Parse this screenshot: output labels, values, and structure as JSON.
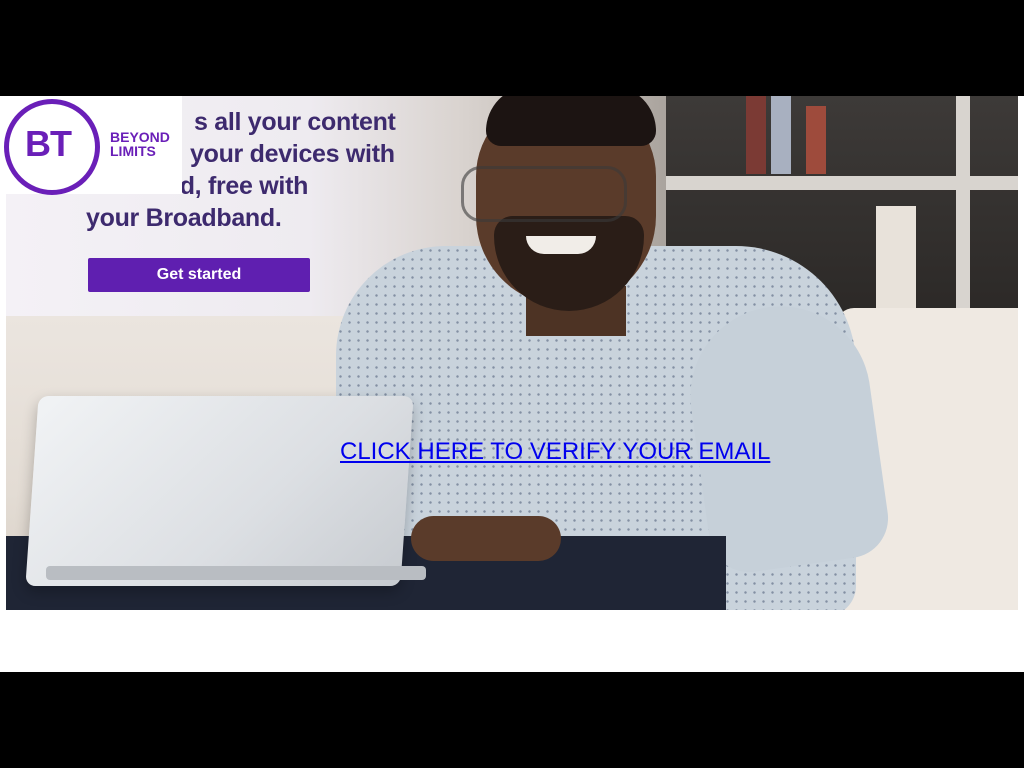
{
  "logo": {
    "mark": "BT",
    "tagline_line1": "BEYOND",
    "tagline_line2": "LIMITS"
  },
  "promo": {
    "line1": "s all your content",
    "line2": "your devices with",
    "line3": "BT Cloud, free with",
    "line4": "your Broadband.",
    "cta_label": "Get started"
  },
  "verify_link": {
    "label": "CLICK HERE TO VERIFY YOUR EMAIL"
  },
  "colors": {
    "brand_purple": "#6a1fb8",
    "cta_purple": "#5f1fb0",
    "link_blue": "#0000ee",
    "background": "#000000"
  }
}
